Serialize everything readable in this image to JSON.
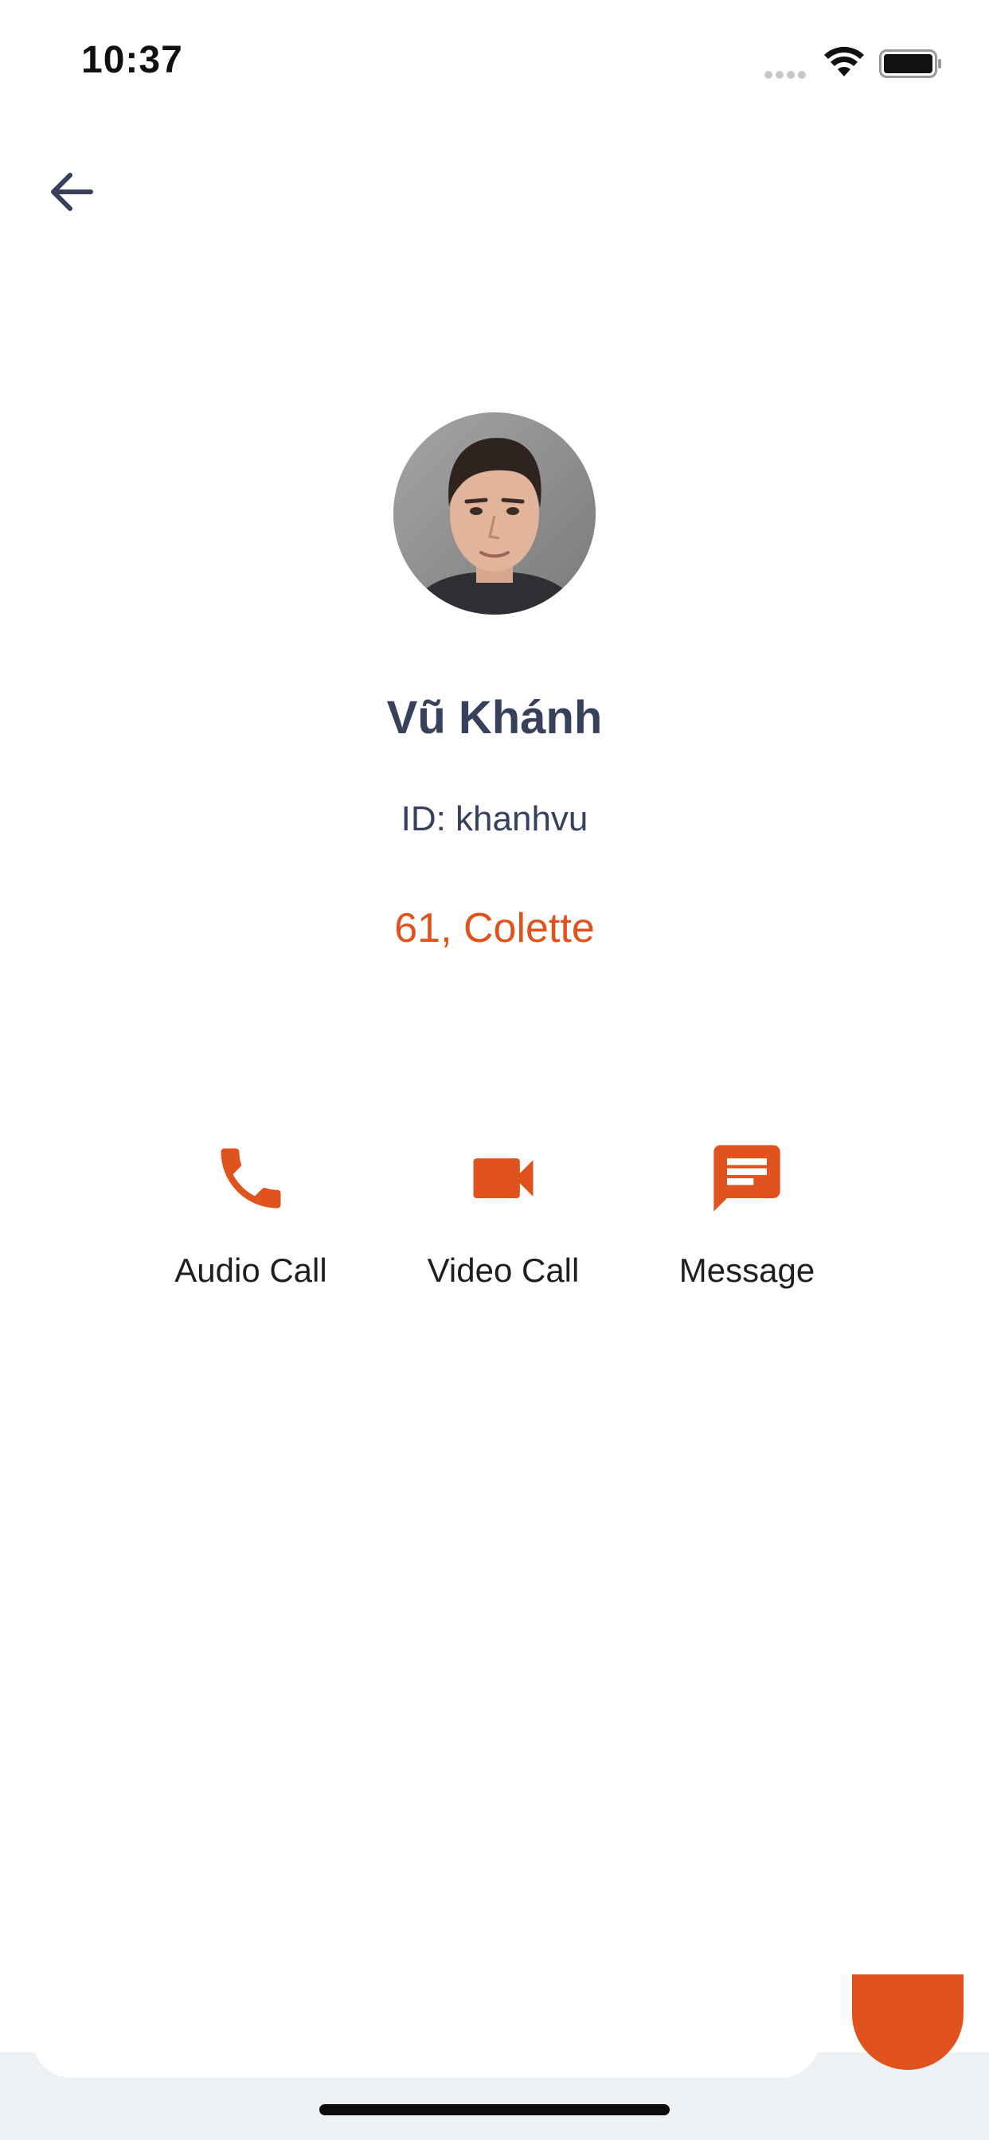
{
  "status_bar": {
    "time": "10:37"
  },
  "navigation": {
    "back_icon": "arrow-left-icon"
  },
  "profile": {
    "avatar_icon": "avatar-photo",
    "name": "Vũ Khánh",
    "id_text": "ID: khanhvu",
    "detail": "61, Colette"
  },
  "actions": [
    {
      "label": "Audio Call",
      "icon": "phone-icon"
    },
    {
      "label": "Video Call",
      "icon": "video-camera-icon"
    },
    {
      "label": "Message",
      "icon": "message-icon"
    }
  ],
  "colors": {
    "accent": "#e0531f",
    "text_primary": "#37415c",
    "label_text": "#1f1f1f"
  }
}
